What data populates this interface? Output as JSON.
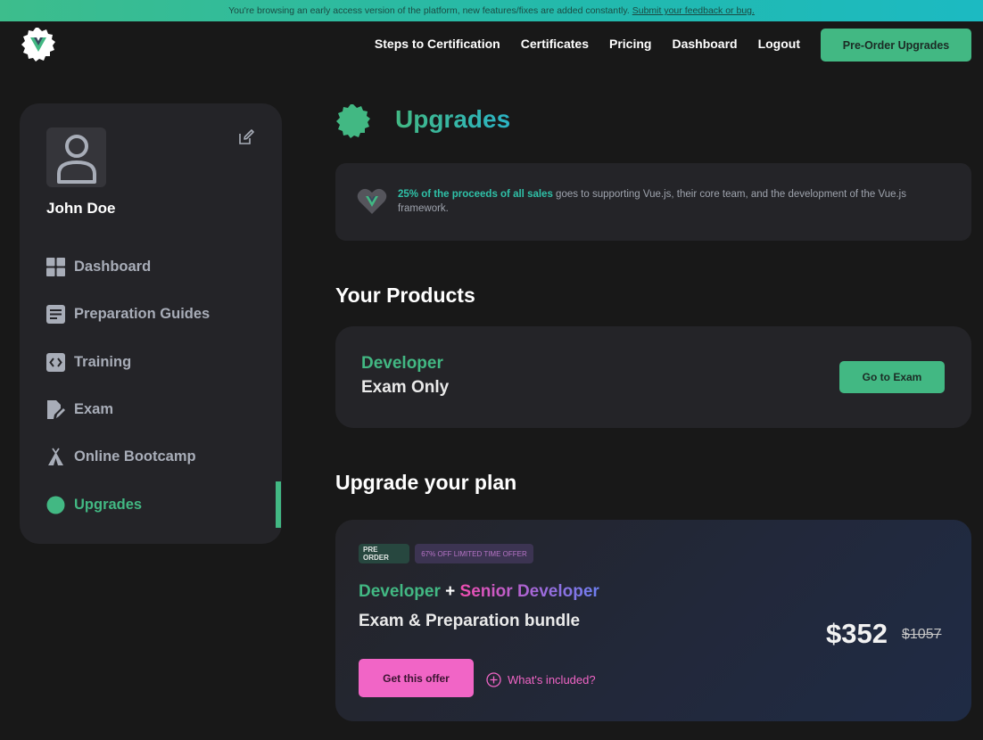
{
  "banner": {
    "text": "You're browsing an early access version of the platform, new features/fixes are added constantly.",
    "link": "Submit your feedback or bug."
  },
  "nav": {
    "links": [
      "Steps to Certification",
      "Certificates",
      "Pricing",
      "Dashboard",
      "Logout"
    ],
    "cta": "Pre-Order Upgrades"
  },
  "sidebar": {
    "username": "John Doe",
    "items": [
      {
        "label": "Dashboard",
        "icon": "grid-icon"
      },
      {
        "label": "Preparation Guides",
        "icon": "document-icon"
      },
      {
        "label": "Training",
        "icon": "code-icon"
      },
      {
        "label": "Exam",
        "icon": "exam-edit-icon"
      },
      {
        "label": "Online Bootcamp",
        "icon": "tent-icon"
      },
      {
        "label": "Upgrades",
        "icon": "badge-icon"
      }
    ],
    "active": "Upgrades"
  },
  "page": {
    "title": "Upgrades",
    "info_highlight": "25% of the proceeds of all sales",
    "info_rest": "goes to supporting Vue.js, their core team, and the development of the Vue.js framework."
  },
  "products": {
    "heading": "Your Products",
    "line1": "Developer",
    "line2": "Exam Only",
    "button": "Go to Exam"
  },
  "upgrade": {
    "heading": "Upgrade your plan",
    "badge_pre": "PRE ORDER",
    "badge_off": "67% OFF LIMITED TIME OFFER",
    "title_a": "Developer",
    "title_plus": "+",
    "title_b": "Senior Developer",
    "subtitle": "Exam & Preparation bundle",
    "price": "$352",
    "old_price": "$1057",
    "button": "Get this offer",
    "included": "What's included?"
  },
  "colors": {
    "accent": "#42b883",
    "pink": "#f165c6",
    "background": "#181818",
    "card": "#242428"
  }
}
